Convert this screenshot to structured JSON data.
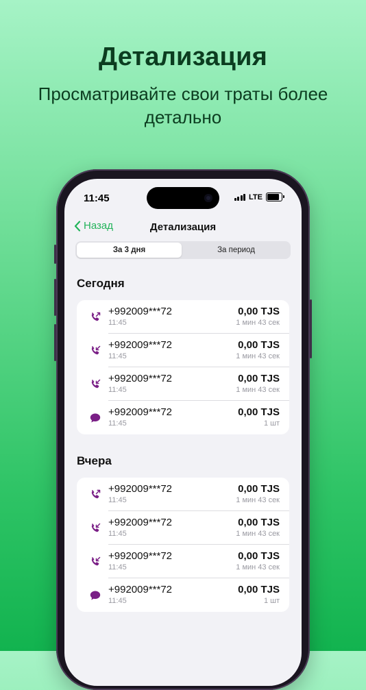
{
  "promo": {
    "title": "Детализация",
    "subtitle": "Просматривайте свои траты более детально"
  },
  "status_bar": {
    "time": "11:45",
    "network": "LTE"
  },
  "nav": {
    "back_label": "Назад",
    "title": "Детализация"
  },
  "segments": [
    {
      "label": "За 3 дня",
      "active": true
    },
    {
      "label": "За период",
      "active": false
    }
  ],
  "sections": [
    {
      "title": "Сегодня",
      "rows": [
        {
          "icon": "outgoing-call-icon",
          "number": "+992009***72",
          "time": "11:45",
          "amount": "0,00 TJS",
          "detail": "1 мин 43 сек"
        },
        {
          "icon": "incoming-call-icon",
          "number": "+992009***72",
          "time": "11:45",
          "amount": "0,00 TJS",
          "detail": "1 мин 43 сек"
        },
        {
          "icon": "incoming-call-icon",
          "number": "+992009***72",
          "time": "11:45",
          "amount": "0,00 TJS",
          "detail": "1 мин 43 сек"
        },
        {
          "icon": "message-icon",
          "number": "+992009***72",
          "time": "11:45",
          "amount": "0,00 TJS",
          "detail": "1 шт"
        }
      ]
    },
    {
      "title": "Вчера",
      "rows": [
        {
          "icon": "outgoing-call-icon",
          "number": "+992009***72",
          "time": "11:45",
          "amount": "0,00 TJS",
          "detail": "1 мин 43 сек"
        },
        {
          "icon": "incoming-call-icon",
          "number": "+992009***72",
          "time": "11:45",
          "amount": "0,00 TJS",
          "detail": "1 мин 43 сек"
        },
        {
          "icon": "incoming-call-icon",
          "number": "+992009***72",
          "time": "11:45",
          "amount": "0,00 TJS",
          "detail": "1 мин 43 сек"
        },
        {
          "icon": "message-icon",
          "number": "+992009***72",
          "time": "11:45",
          "amount": "0,00 TJS",
          "detail": "1 шт"
        }
      ]
    }
  ],
  "colors": {
    "accent": "#22b35a",
    "icon": "#7a1f86",
    "title": "#0c3d20"
  }
}
